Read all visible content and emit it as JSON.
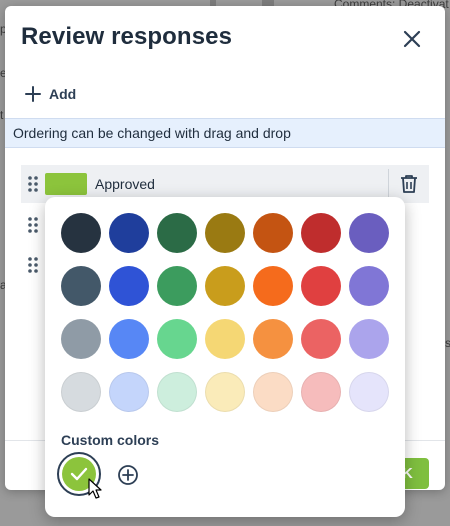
{
  "background": {
    "top_right_text": "Comments: Deactivat",
    "left_frag_1": "p",
    "left_frag_2": "e",
    "left_frag_3": "t",
    "left_frag_4": "a",
    "right_frag": "s"
  },
  "dialog": {
    "title": "Review responses",
    "add_label": "Add",
    "info_text": "Ordering can be changed with drag and drop",
    "responses": [
      {
        "label": "Approved",
        "color": "#8cc43c"
      }
    ],
    "ok_label": "K"
  },
  "picker": {
    "rows": [
      [
        "#263340",
        "#1f3e9c",
        "#2b6b46",
        "#9a7a12",
        "#c45412",
        "#bf2d2d",
        "#6a5ebf"
      ],
      [
        "#435869",
        "#2f53d6",
        "#3c9c5e",
        "#c99d1c",
        "#f56b1c",
        "#e04040",
        "#8076d6"
      ],
      [
        "#8f9ba6",
        "#5787f5",
        "#67d68f",
        "#f5d774",
        "#f59140",
        "#eb6363",
        "#aba4ec"
      ],
      [
        "#d6dbdf",
        "#c4d5fb",
        "#cdeedd",
        "#faebb9",
        "#fbdcc5",
        "#f6bcbc",
        "#e5e4fb"
      ]
    ],
    "custom_title": "Custom colors",
    "custom_selected_color": "#8cc43c"
  }
}
